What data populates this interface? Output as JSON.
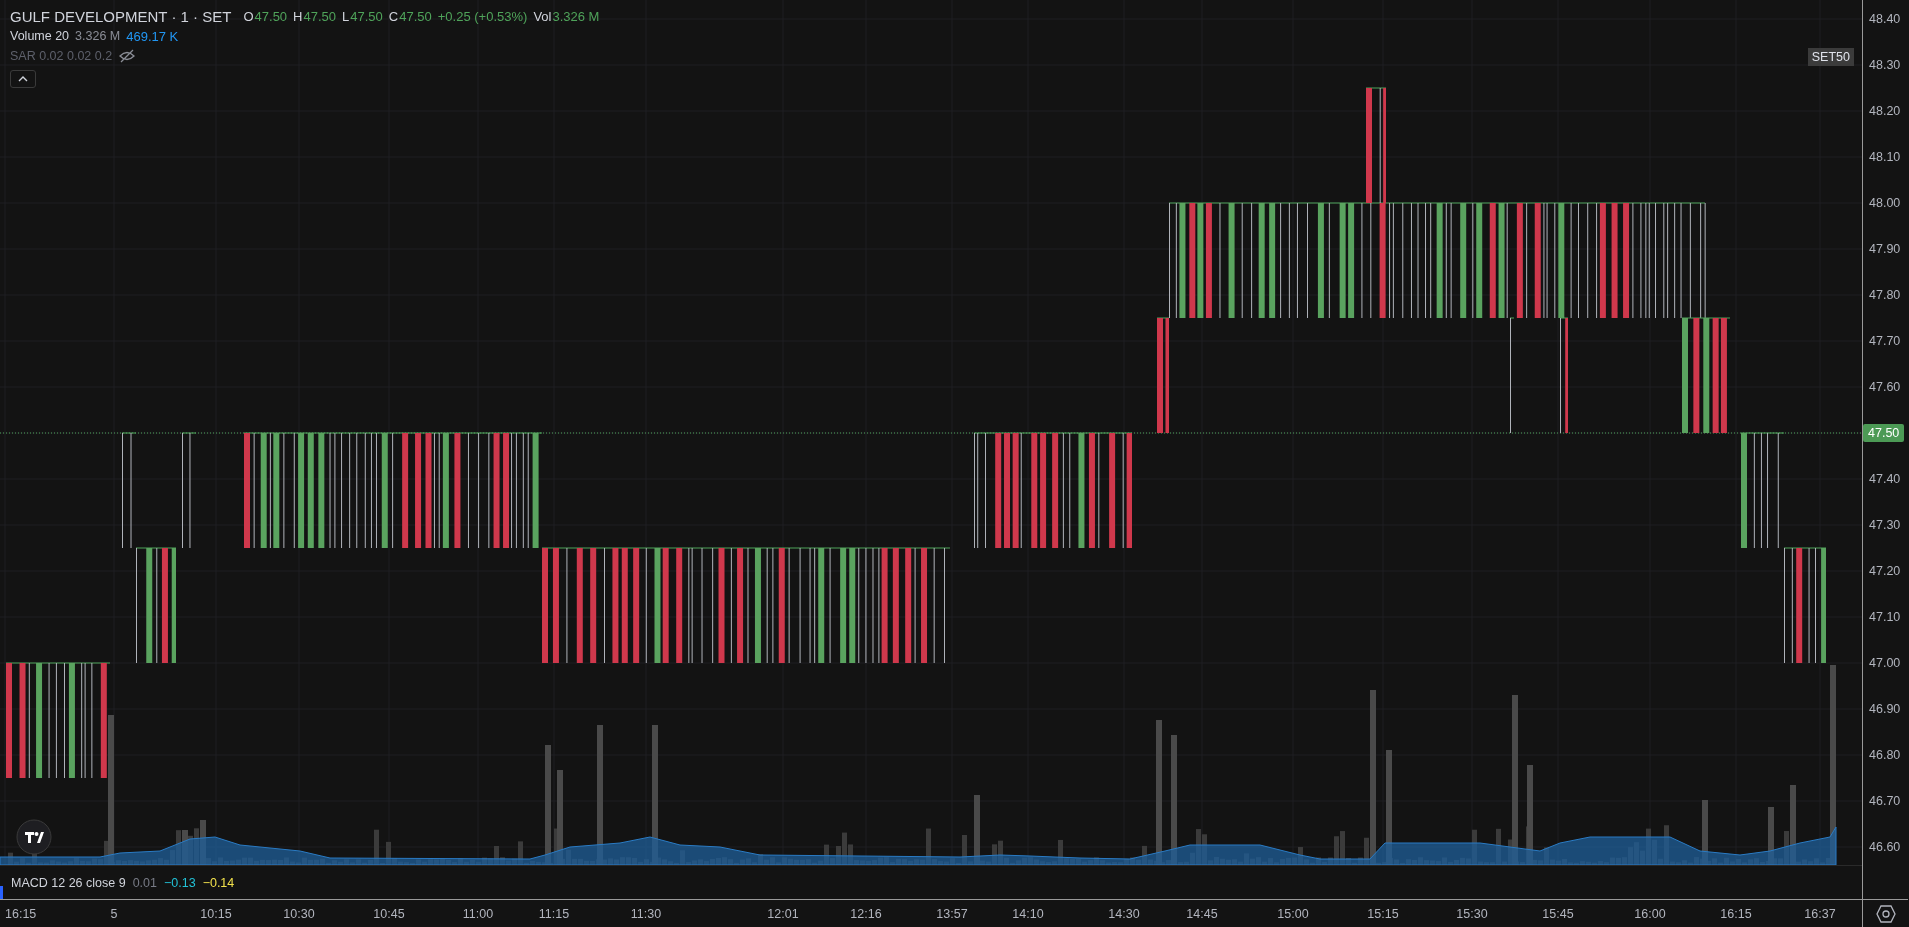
{
  "legend": {
    "title": "GULF DEVELOPMENT · 1 · SET",
    "ohlc": [
      {
        "label": "O",
        "value": "47.50"
      },
      {
        "label": "H",
        "value": "47.50"
      },
      {
        "label": "L",
        "value": "47.50"
      },
      {
        "label": "C",
        "value": "47.50"
      }
    ],
    "change": "+0.25 (+0.53%)",
    "volume_label": "Vol",
    "volume_value": "3.326 M"
  },
  "volume_indicator": {
    "name": "Volume 20",
    "value": "3.326 M",
    "average": "469.17 K"
  },
  "sar_indicator": {
    "name": "SAR 0.02 0.02 0.2",
    "hidden": true
  },
  "symbol_badge": "SET50",
  "price_axis": {
    "labels": [
      "48.40",
      "48.30",
      "48.20",
      "48.10",
      "48.00",
      "47.90",
      "47.80",
      "47.70",
      "47.60",
      "47.40",
      "47.30",
      "47.20",
      "47.10",
      "47.00",
      "46.90",
      "46.80",
      "46.70",
      "46.60"
    ],
    "last_price": "47.50"
  },
  "macd": {
    "name": "MACD 12 26 close 9",
    "values": [
      {
        "text": "0.01",
        "color": "#787b86"
      },
      {
        "text": "−0.13",
        "color": "#22c1d6"
      },
      {
        "text": "−0.14",
        "color": "#f2e14c"
      }
    ]
  },
  "time_axis": {
    "labels": [
      "16:15",
      "5",
      "10:15",
      "10:30",
      "10:45",
      "11:00",
      "11:15",
      "11:30",
      "12:01",
      "12:16",
      "13:57",
      "14:10",
      "14:30",
      "14:45",
      "15:00",
      "15:15",
      "15:30",
      "15:45",
      "16:00",
      "16:15",
      "16:37"
    ]
  }
}
